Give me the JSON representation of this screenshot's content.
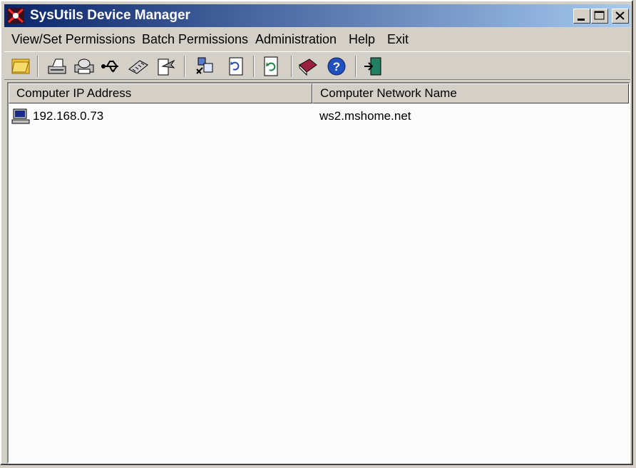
{
  "window": {
    "title": "SysUtils Device Manager"
  },
  "menu": {
    "view_set_permissions": "View/Set Permissions",
    "batch_permissions": "Batch Permissions",
    "administration": "Administration",
    "help": "Help",
    "exit": "Exit"
  },
  "toolbar": {
    "icons": [
      "open-folder-icon",
      "scanner-icon",
      "printer-icon",
      "usb-icon",
      "memory-chip-icon",
      "removable-drive-icon",
      "batch-users-icon",
      "batch-refresh-icon",
      "refresh-icon",
      "book-icon",
      "help-icon",
      "exit-door-icon"
    ]
  },
  "list": {
    "columns": [
      "Computer IP Address",
      "Computer Network Name"
    ],
    "rows": [
      {
        "ip": "192.168.0.73",
        "name": "ws2.mshome.net",
        "icon": "computer-icon"
      }
    ]
  },
  "colors": {
    "titlebar_start": "#0a246a",
    "titlebar_end": "#a6caf0",
    "face": "#d4d0c8"
  }
}
